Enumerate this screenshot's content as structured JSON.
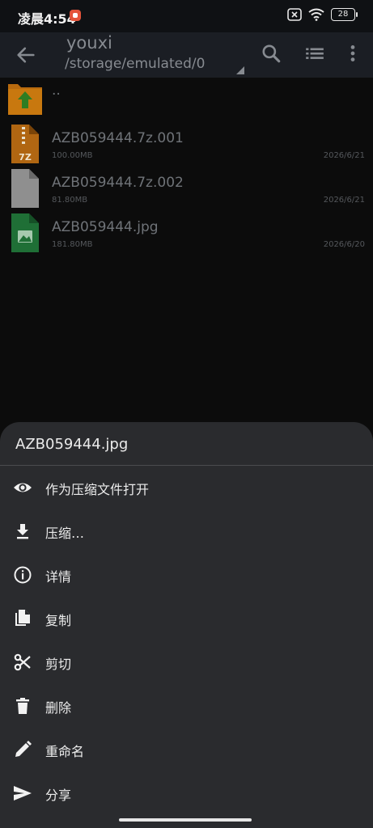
{
  "status_bar": {
    "time": "凌晨4:54",
    "battery": "28"
  },
  "app_bar": {
    "title": "youxi",
    "path": "/storage/emulated/0"
  },
  "files": [
    {
      "name": "..",
      "size": "",
      "date": "",
      "icon": "parent-folder-icon"
    },
    {
      "name": "AZB059444.7z.001",
      "size": "100.00MB",
      "date": "2026/6/21",
      "icon": "7z-archive-icon"
    },
    {
      "name": "AZB059444.7z.002",
      "size": "81.80MB",
      "date": "2026/6/21",
      "icon": "generic-file-icon"
    },
    {
      "name": "AZB059444.jpg",
      "size": "181.80MB",
      "date": "2026/6/20",
      "icon": "image-file-icon"
    }
  ],
  "sheet": {
    "title": "AZB059444.jpg",
    "items": [
      {
        "label": "作为压缩文件打开",
        "icon": "eye-icon"
      },
      {
        "label": "压缩…",
        "icon": "download-icon"
      },
      {
        "label": "详情",
        "icon": "info-icon"
      },
      {
        "label": "复制",
        "icon": "copy-icon"
      },
      {
        "label": "剪切",
        "icon": "scissors-icon"
      },
      {
        "label": "删除",
        "icon": "trash-icon"
      },
      {
        "label": "重命名",
        "icon": "pencil-icon"
      },
      {
        "label": "分享",
        "icon": "send-icon"
      }
    ]
  }
}
